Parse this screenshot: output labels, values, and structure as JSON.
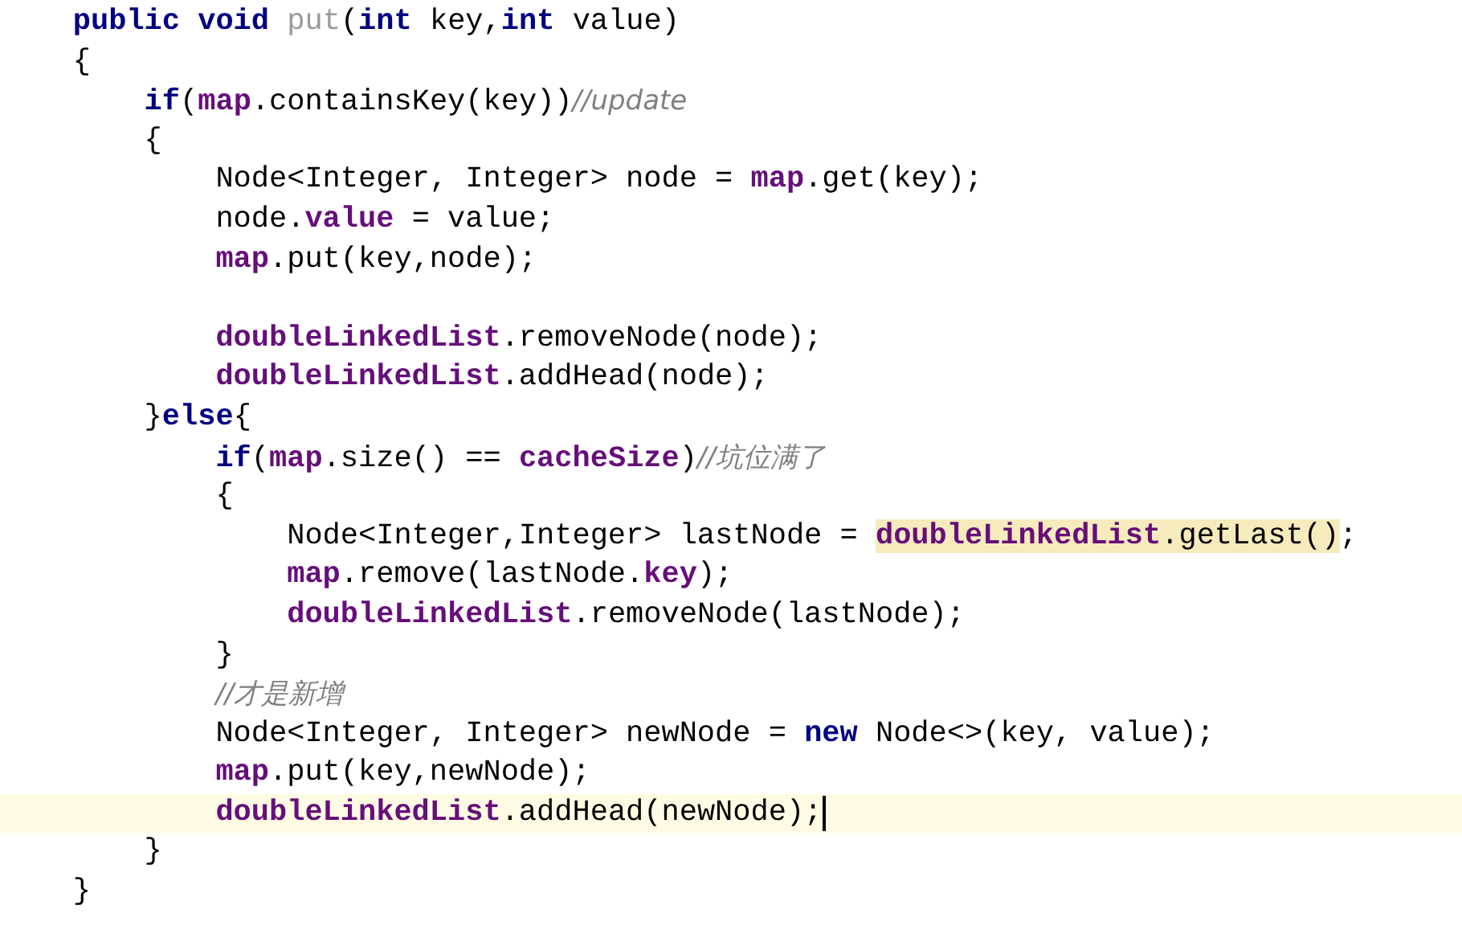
{
  "editor": {
    "lines": [
      {
        "tokens": [
          {
            "kind": "keyword",
            "text": "public void "
          },
          {
            "kind": "unused",
            "text": "put"
          },
          {
            "kind": "plain",
            "text": "("
          },
          {
            "kind": "keyword",
            "text": "int "
          },
          {
            "kind": "plain",
            "text": "key,"
          },
          {
            "kind": "keyword",
            "text": "int "
          },
          {
            "kind": "plain",
            "text": "value)"
          }
        ]
      },
      {
        "tokens": [
          {
            "kind": "plain",
            "text": "{"
          }
        ],
        "children": [
          {
            "tokens": [
              {
                "kind": "keyword",
                "text": "if"
              },
              {
                "kind": "plain",
                "text": "("
              },
              {
                "kind": "field",
                "text": "map"
              },
              {
                "kind": "plain",
                "text": ".containsKey(key))"
              },
              {
                "kind": "comment",
                "text": "//update"
              }
            ]
          },
          {
            "tokens": [
              {
                "kind": "plain",
                "text": "{"
              }
            ],
            "children": [
              {
                "tokens": [
                  {
                    "kind": "plain",
                    "text": "Node<Integer, Integer> node = "
                  },
                  {
                    "kind": "field",
                    "text": "map"
                  },
                  {
                    "kind": "plain",
                    "text": ".get(key);"
                  }
                ]
              },
              {
                "tokens": [
                  {
                    "kind": "plain",
                    "text": "node."
                  },
                  {
                    "kind": "field",
                    "text": "value"
                  },
                  {
                    "kind": "plain",
                    "text": " = value;"
                  }
                ]
              },
              {
                "gap_after": true,
                "tokens": [
                  {
                    "kind": "field",
                    "text": "map"
                  },
                  {
                    "kind": "plain",
                    "text": ".put(key,node);"
                  }
                ]
              },
              {
                "tokens": [
                  {
                    "kind": "field",
                    "text": "doubleLinkedList"
                  },
                  {
                    "kind": "plain",
                    "text": ".removeNode(node);"
                  }
                ]
              },
              {
                "tokens": [
                  {
                    "kind": "field",
                    "text": "doubleLinkedList"
                  },
                  {
                    "kind": "plain",
                    "text": ".addHead(node);"
                  }
                ]
              }
            ]
          },
          {
            "tokens": [
              {
                "kind": "plain",
                "text": "}"
              },
              {
                "kind": "keyword",
                "text": "else"
              },
              {
                "kind": "plain",
                "text": "{"
              }
            ],
            "children": [
              {
                "tokens": [
                  {
                    "kind": "keyword",
                    "text": "if"
                  },
                  {
                    "kind": "plain",
                    "text": "("
                  },
                  {
                    "kind": "field",
                    "text": "map"
                  },
                  {
                    "kind": "plain",
                    "text": ".size() == "
                  },
                  {
                    "kind": "field",
                    "text": "cacheSize"
                  },
                  {
                    "kind": "plain",
                    "text": ")"
                  },
                  {
                    "kind": "comment",
                    "text": "//坑位满了"
                  }
                ]
              },
              {
                "tokens": [
                  {
                    "kind": "plain",
                    "text": "{"
                  }
                ],
                "children": [
                  {
                    "tokens": [
                      {
                        "kind": "plain",
                        "text": "Node<Integer,Integer> lastNode = "
                      },
                      {
                        "kind": "field",
                        "text": "doubleLinkedList",
                        "highlighted": true
                      },
                      {
                        "kind": "plain",
                        "text": ".getLast()",
                        "highlighted": true
                      },
                      {
                        "kind": "plain",
                        "text": ";"
                      }
                    ]
                  },
                  {
                    "tokens": [
                      {
                        "kind": "field",
                        "text": "map"
                      },
                      {
                        "kind": "plain",
                        "text": ".remove(lastNode."
                      },
                      {
                        "kind": "field",
                        "text": "key"
                      },
                      {
                        "kind": "plain",
                        "text": ");"
                      }
                    ]
                  },
                  {
                    "tokens": [
                      {
                        "kind": "field",
                        "text": "doubleLinkedList"
                      },
                      {
                        "kind": "plain",
                        "text": ".removeNode(lastNode);"
                      }
                    ]
                  }
                ]
              },
              {
                "tokens": [
                  {
                    "kind": "plain",
                    "text": "}"
                  }
                ]
              },
              {
                "tokens": [
                  {
                    "kind": "comment",
                    "text": "//才是新增"
                  }
                ]
              },
              {
                "tokens": [
                  {
                    "kind": "plain",
                    "text": "Node<Integer, Integer> newNode = "
                  },
                  {
                    "kind": "keyword",
                    "text": "new"
                  },
                  {
                    "kind": "plain",
                    "text": " Node<>(key, value);"
                  }
                ]
              },
              {
                "tokens": [
                  {
                    "kind": "field",
                    "text": "map"
                  },
                  {
                    "kind": "plain",
                    "text": ".put(key,newNode);"
                  }
                ]
              },
              {
                "current": true,
                "tokens": [
                  {
                    "kind": "field",
                    "text": "doubleLinkedList"
                  },
                  {
                    "kind": "plain",
                    "text": ".addHead(newNode);"
                  }
                ]
              }
            ]
          },
          {
            "tokens": [
              {
                "kind": "plain",
                "text": "}"
              }
            ]
          }
        ]
      },
      {
        "tokens": [
          {
            "kind": "plain",
            "text": "}"
          }
        ]
      }
    ]
  }
}
